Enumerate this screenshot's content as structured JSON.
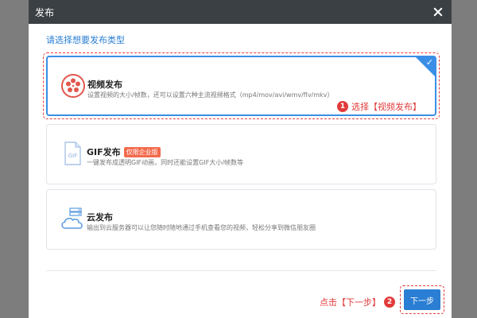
{
  "dialog": {
    "title": "发布",
    "prompt": "请选择想要发布类型"
  },
  "options": [
    {
      "title": "视频发布",
      "description": "设置视频的大小/帧数，还可以设置六种主流视频格式（mp4/mov/avi/wmv/flv/mkv）",
      "selected": true,
      "icon": "film-reel-icon"
    },
    {
      "title": "GIF发布",
      "tag": "仅限企业版",
      "description": "一键发布成透明GIF动画，同时还能设置GIF大小/帧数等",
      "selected": false,
      "icon": "gif-file-icon"
    },
    {
      "title": "云发布",
      "description": "输出到云服务器可以让您随时随地通过手机查看您的视频，轻松分享到微信朋友圈",
      "selected": false,
      "icon": "cloud-server-icon"
    }
  ],
  "annotations": {
    "step1_number": "1",
    "step1_text": "选择【视频发布】",
    "step2_number": "2",
    "step2_text": "点击【下一步】"
  },
  "footer": {
    "next_label": "下一步"
  },
  "colors": {
    "accent": "#2a7ed3",
    "annotation": "#e23b3b",
    "tag": "#f36a4c",
    "titlebar": "#3b4044"
  }
}
